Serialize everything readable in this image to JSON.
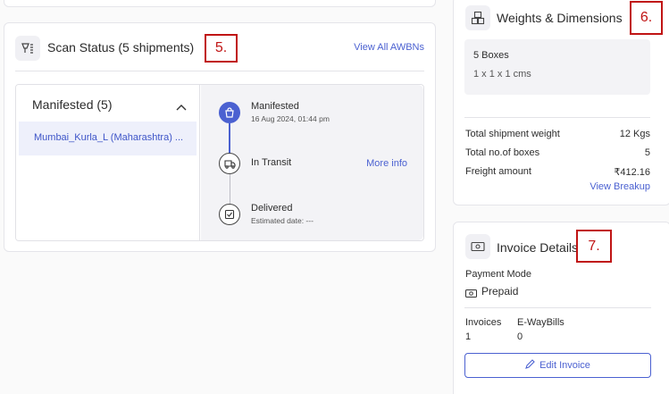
{
  "scan_status": {
    "title": "Scan Status (5 shipments)",
    "view_all": "View All AWBNs",
    "marker": "5.",
    "group_title": "Manifested (5)",
    "selected_item": "Mumbai_Kurla_L (Maharashtra) ...",
    "timeline": [
      {
        "label": "Manifested",
        "sub": "16 Aug 2024, 01:44 pm",
        "state": "done",
        "icon": "shopping-bag-icon"
      },
      {
        "label": "In Transit",
        "sub": "",
        "state": "pending",
        "icon": "truck-icon",
        "action": "More info"
      },
      {
        "label": "Delivered",
        "sub": "Estimated date: ---",
        "state": "pending",
        "icon": "package-check-icon"
      }
    ]
  },
  "weights": {
    "title": "Weights & Dimensions",
    "marker": "6.",
    "box_count": "5 Boxes",
    "box_dims": "1 x 1 x 1 cms",
    "rows": [
      {
        "label": "Total shipment weight",
        "value": "12 Kgs"
      },
      {
        "label": "Total no.of boxes",
        "value": "5"
      },
      {
        "label": "Freight amount",
        "value": "₹412.16"
      }
    ],
    "breakup_link": "View Breakup"
  },
  "invoice": {
    "title": "Invoice Details",
    "marker": "7.",
    "payment_mode_label": "Payment Mode",
    "payment_mode_value": "Prepaid",
    "invoices_label": "Invoices",
    "invoices_value": "1",
    "ewaybills_label": "E-WayBills",
    "ewaybills_value": "0",
    "edit_button": "Edit Invoice"
  },
  "colors": {
    "accent": "#4b61d1",
    "marker": "#c01414",
    "selected_bg": "#eef0fb"
  }
}
